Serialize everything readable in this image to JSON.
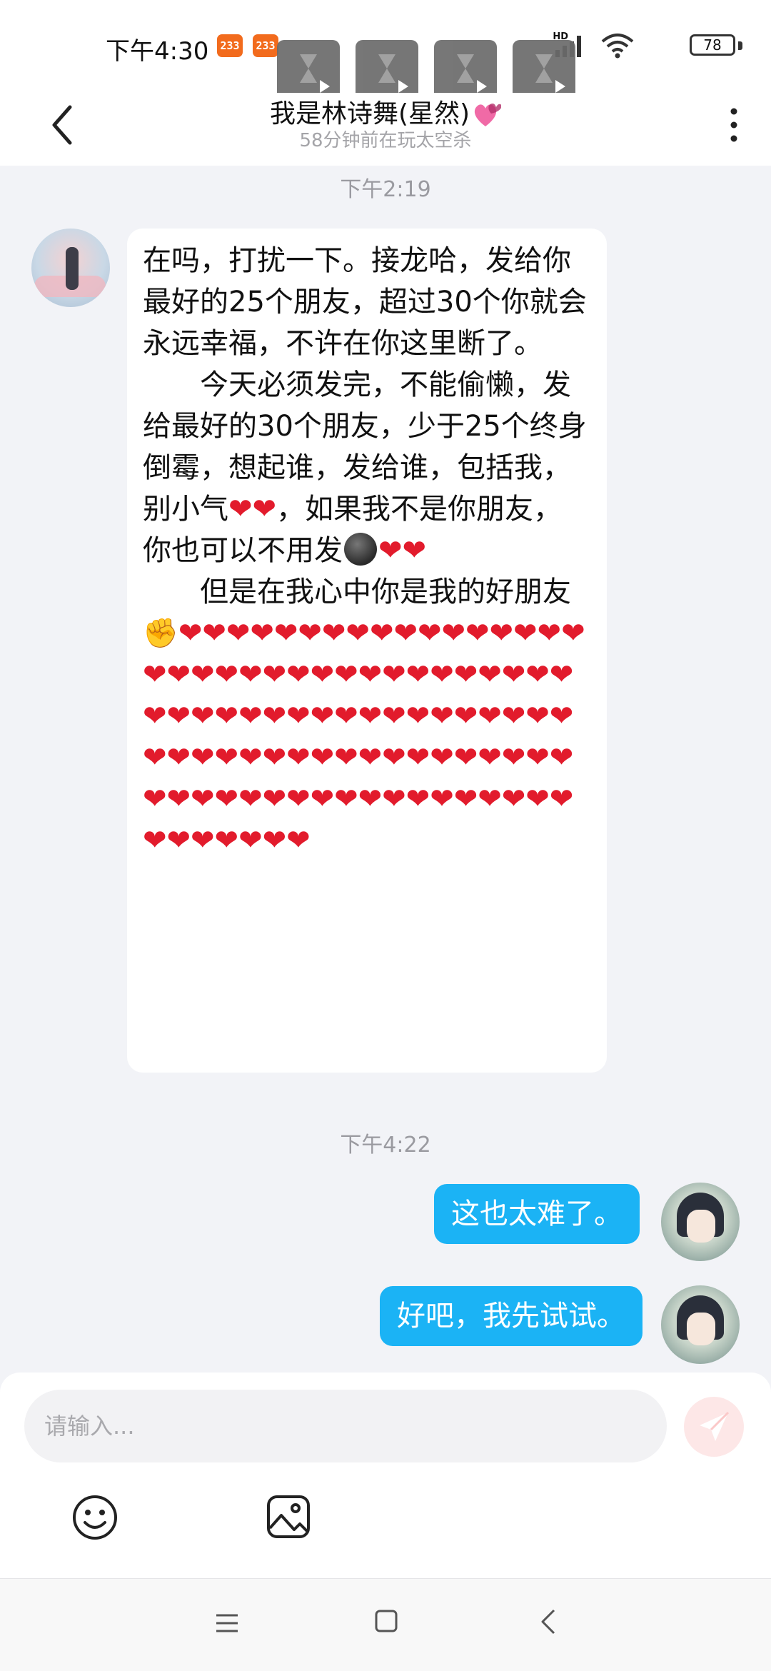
{
  "status_bar": {
    "time": "下午4:30",
    "badges": [
      "233",
      "233"
    ],
    "network_label": "HD",
    "battery": "78"
  },
  "header": {
    "title": "我是林诗舞(星然)",
    "subtitle": "58分钟前在玩太空杀",
    "back_icon": "back-chevron-icon",
    "more_icon": "more-vertical-icon"
  },
  "messages": {
    "ts1": "下午2:19",
    "incoming": {
      "p1": "在吗，打扰一下。接龙哈，发给你最好的25个朋友，超过30个你就会永远幸福，不许在你这里断了。",
      "p2": "　　今天必须发完，不能偷懒，发给最好的30个朋友，少于25个终身倒霉，想起谁，发给谁，包括我，别小气",
      "p3": "，如果我不是你朋友，你也可以不用发",
      "p4": "　　但是在我心中你是我的好朋友",
      "hearts_pair": "❤❤",
      "hearts_tail": "❤❤❤❤❤❤❤❤❤❤❤❤❤❤❤❤❤❤❤❤❤❤❤❤❤❤❤❤❤❤❤❤❤❤❤❤❤❤❤❤❤❤❤❤❤❤❤❤❤❤❤❤❤❤❤❤❤❤❤❤❤❤❤❤❤❤❤❤❤❤❤❤❤❤❤❤❤❤❤❤❤❤❤❤❤❤❤❤❤❤❤❤❤❤❤❤",
      "fist": "✊"
    },
    "ts2": "下午4:22",
    "outgoing_1": "这也太难了。",
    "outgoing_2": "好吧，我先试试。"
  },
  "input": {
    "placeholder": "请输入..."
  },
  "colors": {
    "bubble_out": "#1bb3f5",
    "heart": "#e21b2c",
    "send_disabled": "#fde7e7"
  }
}
